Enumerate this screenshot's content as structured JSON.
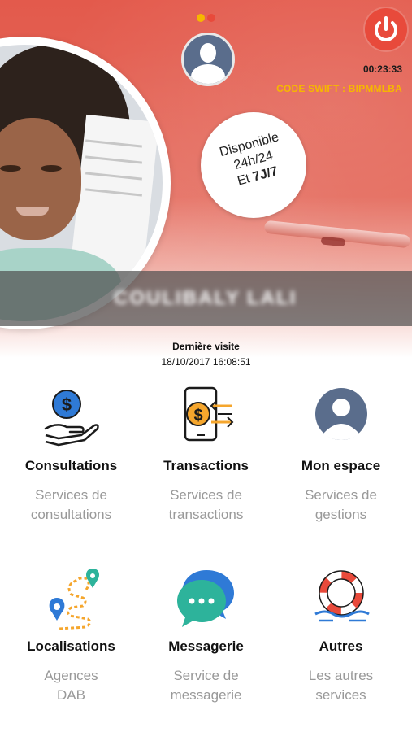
{
  "header": {
    "timer": "00:23:33",
    "swift_code": "CODE SWIFT :  BIPMMLBA",
    "page_dots": [
      {
        "color": "#f6b700",
        "active": true
      },
      {
        "color": "#e84a3b",
        "active": false
      }
    ],
    "power_icon": "power-icon",
    "accent": "#e84a3b"
  },
  "availability": {
    "line1": "Disponible",
    "line2": "24h/24",
    "line3_prefix": "Et ",
    "line3_bold": "7J/7"
  },
  "user": {
    "name_blurred": "COULIBALY LALI"
  },
  "last_visit": {
    "label": "Dernière visite",
    "datetime": "18/10/2017 16:08:51"
  },
  "menu": [
    {
      "title": "Consultations",
      "subtitle_1": "Services de",
      "subtitle_2": "consultations",
      "icon": "hand-dollar-icon"
    },
    {
      "title": "Transactions",
      "subtitle_1": "Services de",
      "subtitle_2": "transactions",
      "icon": "phone-transfer-icon"
    },
    {
      "title": "Mon espace",
      "subtitle_1": "Services de",
      "subtitle_2": "gestions",
      "icon": "user-avatar-icon"
    },
    {
      "title": "Localisations",
      "subtitle_1": "Agences",
      "subtitle_2": "DAB",
      "icon": "map-pins-icon"
    },
    {
      "title": "Messagerie",
      "subtitle_1": "Service de",
      "subtitle_2": "messagerie",
      "icon": "chat-bubbles-icon"
    },
    {
      "title": "Autres",
      "subtitle_1": "Les autres",
      "subtitle_2": "services",
      "icon": "lifebuoy-icon"
    }
  ]
}
